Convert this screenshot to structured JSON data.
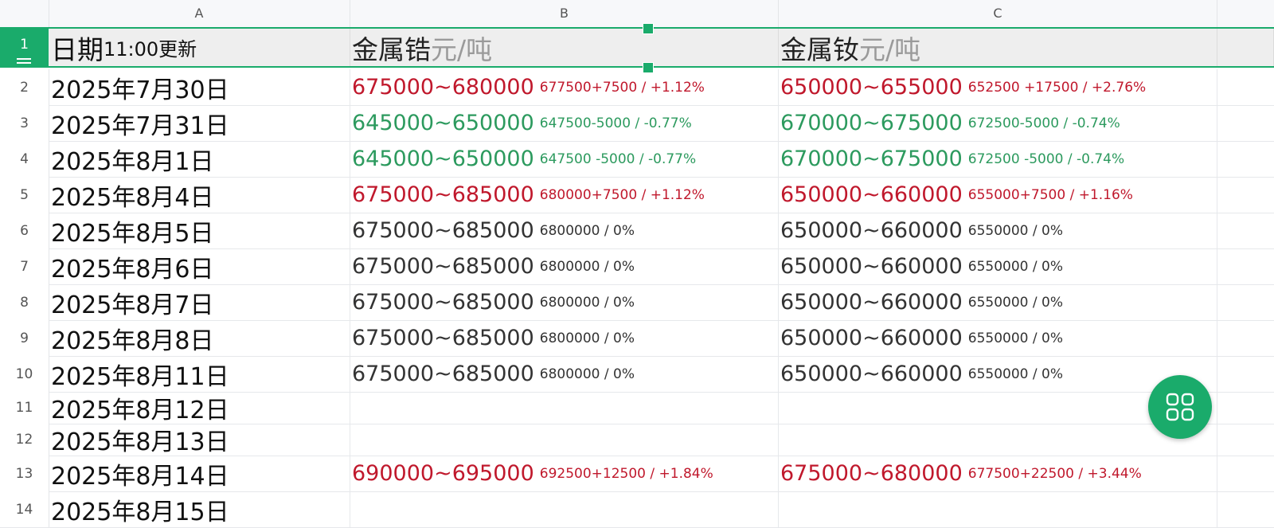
{
  "columns": [
    "A",
    "B",
    "C"
  ],
  "header": {
    "row_number": "1",
    "date_label": "日期",
    "date_sub": "11:00更新",
    "metal_b": "金属锆",
    "unit_b": "元/吨",
    "metal_c": "金属钕",
    "unit_c": "元/吨"
  },
  "colors": {
    "up": "#c0182c",
    "down": "#2c9a5e",
    "flat": "#333333",
    "accent": "#1aab6b"
  },
  "rows": [
    {
      "n": "2",
      "date": "2025年7月30日",
      "b_trend": "up",
      "b_range": "675000~680000",
      "b_detail": "677500+7500 / +1.12%",
      "c_trend": "up",
      "c_range": "650000~655000",
      "c_detail": "652500 +17500 / +2.76%"
    },
    {
      "n": "3",
      "date": "2025年7月31日",
      "b_trend": "down",
      "b_range": "645000~650000",
      "b_detail": "647500-5000 / -0.77%",
      "c_trend": "down",
      "c_range": "670000~675000",
      "c_detail": "672500-5000 / -0.74%"
    },
    {
      "n": "4",
      "date": "2025年8月1日",
      "b_trend": "down",
      "b_range": "645000~650000",
      "b_detail": "647500 -5000 / -0.77%",
      "c_trend": "down",
      "c_range": "670000~675000",
      "c_detail": "672500 -5000 / -0.74%"
    },
    {
      "n": "5",
      "date": "2025年8月4日",
      "b_trend": "up",
      "b_range": "675000~685000",
      "b_detail": "680000+7500 / +1.12%",
      "c_trend": "up",
      "c_range": "650000~660000",
      "c_detail": "655000+7500 / +1.16%"
    },
    {
      "n": "6",
      "date": "2025年8月5日",
      "b_trend": "flat",
      "b_range": "675000~685000",
      "b_detail": "6800000 / 0%",
      "c_trend": "flat",
      "c_range": "650000~660000",
      "c_detail": "6550000 / 0%"
    },
    {
      "n": "7",
      "date": "2025年8月6日",
      "b_trend": "flat",
      "b_range": "675000~685000",
      "b_detail": "6800000 / 0%",
      "c_trend": "flat",
      "c_range": "650000~660000",
      "c_detail": "6550000 / 0%"
    },
    {
      "n": "8",
      "date": "2025年8月7日",
      "b_trend": "flat",
      "b_range": "675000~685000",
      "b_detail": "6800000 / 0%",
      "c_trend": "flat",
      "c_range": "650000~660000",
      "c_detail": "6550000 / 0%"
    },
    {
      "n": "9",
      "date": "2025年8月8日",
      "b_trend": "flat",
      "b_range": "675000~685000",
      "b_detail": "6800000 / 0%",
      "c_trend": "flat",
      "c_range": "650000~660000",
      "c_detail": "6550000 / 0%"
    },
    {
      "n": "10",
      "date": "2025年8月11日",
      "b_trend": "flat",
      "b_range": "675000~685000",
      "b_detail": "6800000 / 0%",
      "c_trend": "flat",
      "c_range": "650000~660000",
      "c_detail": "6550000 / 0%"
    },
    {
      "n": "11",
      "date": "2025年8月12日",
      "b_trend": "flat",
      "b_range": "",
      "b_detail": "",
      "c_trend": "flat",
      "c_range": "",
      "c_detail": ""
    },
    {
      "n": "12",
      "date": "2025年8月13日",
      "b_trend": "flat",
      "b_range": "",
      "b_detail": "",
      "c_trend": "flat",
      "c_range": "",
      "c_detail": ""
    },
    {
      "n": "13",
      "date": "2025年8月14日",
      "b_trend": "up",
      "b_range": "690000~695000",
      "b_detail": "692500+12500 / +1.84%",
      "c_trend": "up",
      "c_range": "675000~680000",
      "c_detail": "677500+22500 / +3.44%"
    },
    {
      "n": "14",
      "date": "2025年8月15日",
      "b_trend": "flat",
      "b_range": "",
      "b_detail": "",
      "c_trend": "flat",
      "c_range": "",
      "c_detail": ""
    }
  ],
  "fab": {
    "icon": "grid-apps-icon"
  }
}
